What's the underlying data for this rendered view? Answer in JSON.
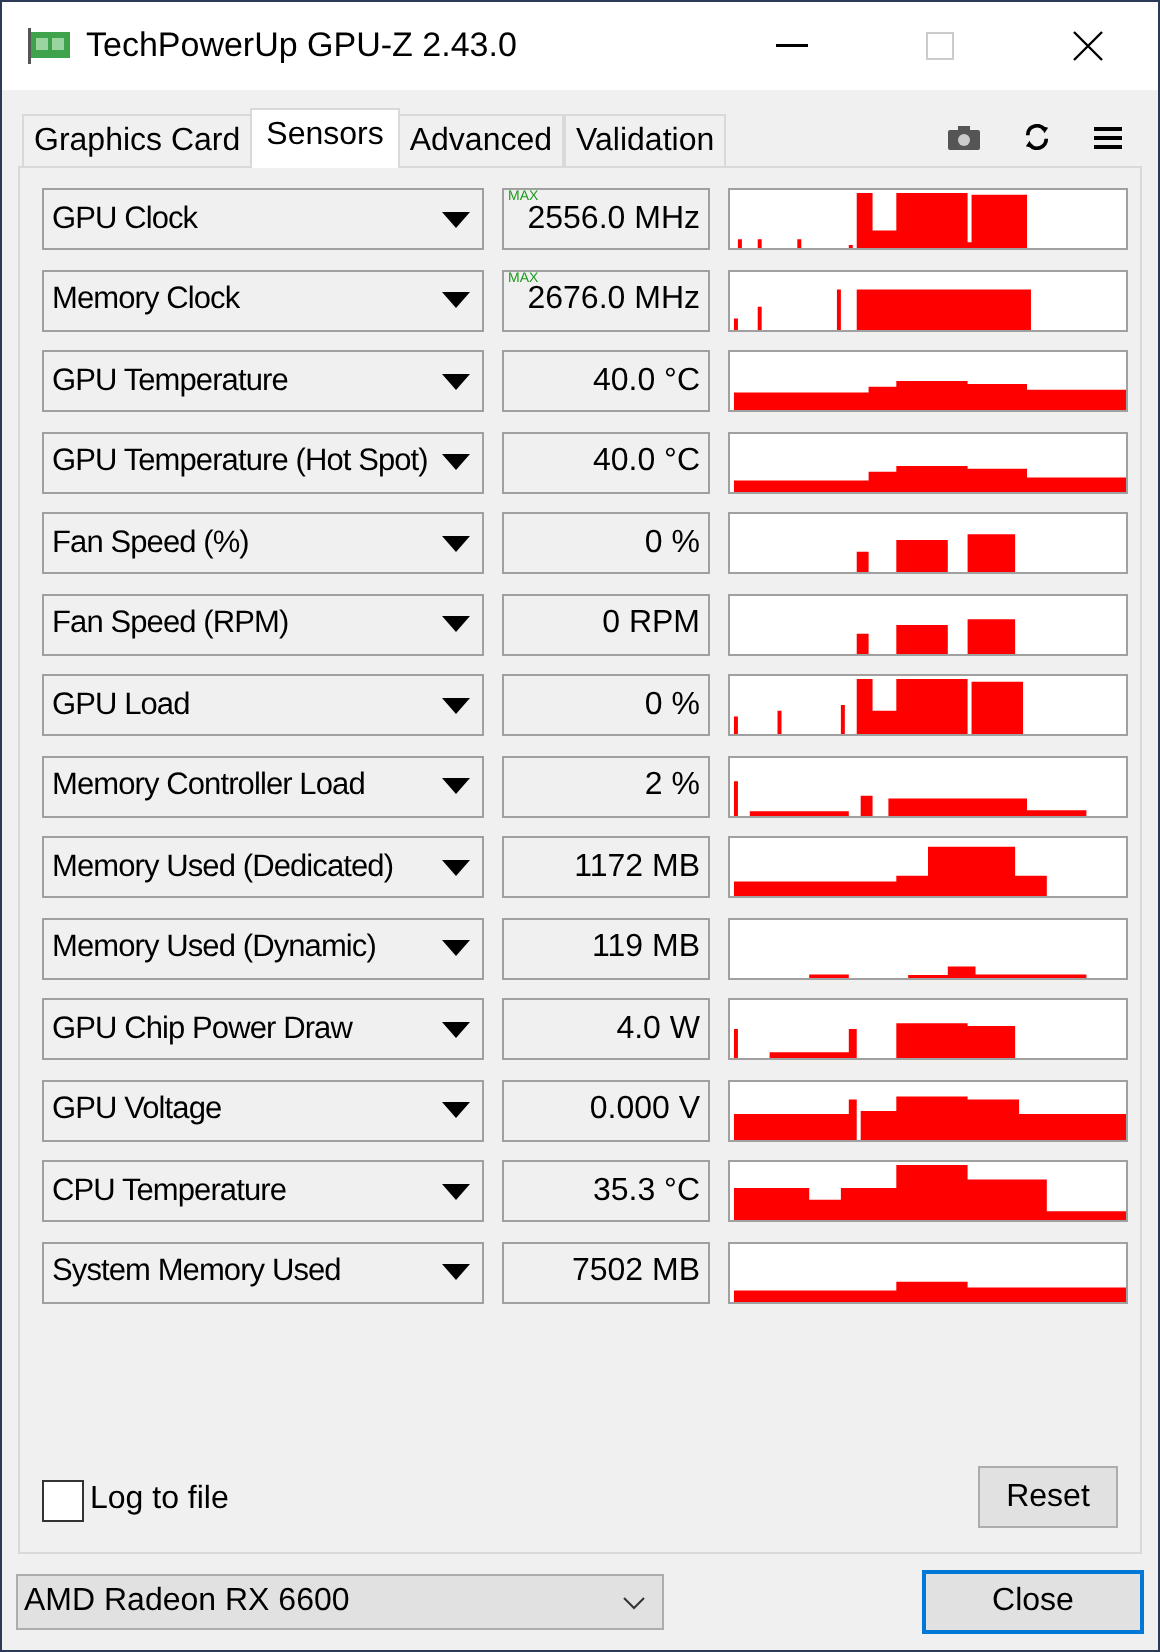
{
  "window": {
    "title": "TechPowerUp GPU-Z 2.43.0"
  },
  "tabs": [
    {
      "label": "Graphics Card",
      "selected": false
    },
    {
      "label": "Sensors",
      "selected": true
    },
    {
      "label": "Advanced",
      "selected": false
    },
    {
      "label": "Validation",
      "selected": false
    }
  ],
  "sensors": [
    {
      "name": "GPU Clock",
      "badge": "MAX",
      "value": "2556.0 MHz"
    },
    {
      "name": "Memory Clock",
      "badge": "MAX",
      "value": "2676.0 MHz"
    },
    {
      "name": "GPU Temperature",
      "value": "40.0 °C"
    },
    {
      "name": "GPU Temperature (Hot Spot)",
      "value": "40.0 °C"
    },
    {
      "name": "Fan Speed (%)",
      "value": "0 %"
    },
    {
      "name": "Fan Speed (RPM)",
      "value": "0 RPM"
    },
    {
      "name": "GPU Load",
      "value": "0 %"
    },
    {
      "name": "Memory Controller Load",
      "value": "2 %"
    },
    {
      "name": "Memory Used (Dedicated)",
      "value": "1172 MB"
    },
    {
      "name": "Memory Used (Dynamic)",
      "value": "119 MB"
    },
    {
      "name": "GPU Chip Power Draw",
      "value": "4.0 W"
    },
    {
      "name": "GPU Voltage",
      "value": "0.000 V"
    },
    {
      "name": "CPU Temperature",
      "value": "35.3 °C"
    },
    {
      "name": "System Memory Used",
      "value": "7502 MB"
    }
  ],
  "log_to_file": {
    "label": "Log to file",
    "checked": false
  },
  "reset_button": "Reset",
  "device_select": {
    "value": "AMD Radeon RX 6600"
  },
  "close_button": "Close"
}
